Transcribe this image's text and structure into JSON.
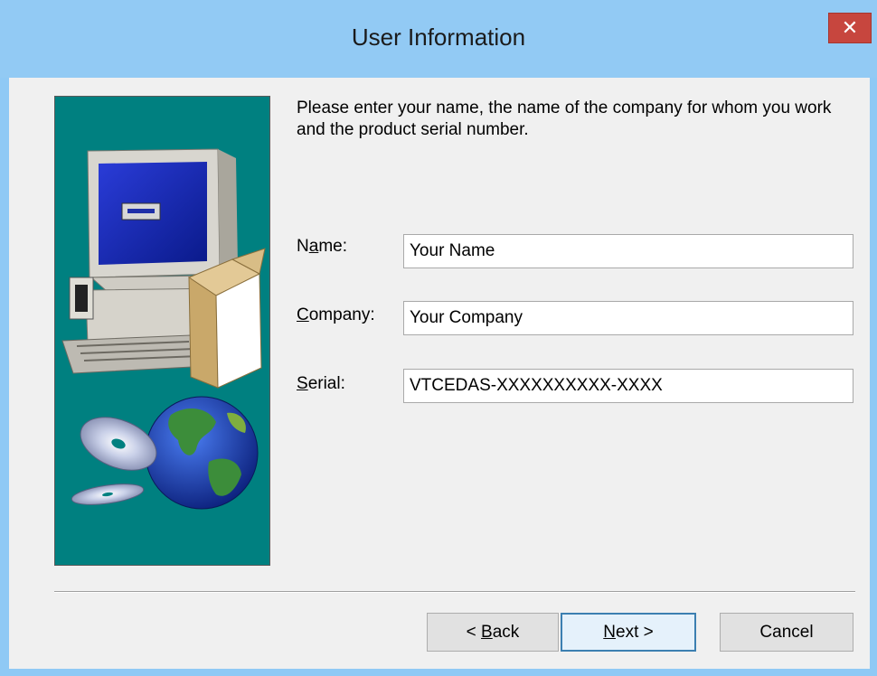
{
  "window": {
    "title": "User Information",
    "close_glyph": "✕"
  },
  "intro_text": "Please enter your name, the name of the company for whom you work and the product serial number.",
  "fields": {
    "name": {
      "label_pre": "N",
      "label_ul": "a",
      "label_post": "me:",
      "value": "Your Name"
    },
    "company": {
      "label_pre": "",
      "label_ul": "C",
      "label_post": "ompany:",
      "value": "Your Company"
    },
    "serial": {
      "label_pre": "",
      "label_ul": "S",
      "label_post": "erial:",
      "value": "VTCEDAS-XXXXXXXXXX-XXXX"
    }
  },
  "buttons": {
    "back": {
      "pre": "< ",
      "ul": "B",
      "post": "ack"
    },
    "next": {
      "pre": "",
      "ul": "N",
      "post": "ext >"
    },
    "cancel": {
      "label": "Cancel"
    }
  },
  "colors": {
    "titlebar": "#92caf4",
    "close_button": "#c7463e",
    "graphic_background": "#008080",
    "dialog_background": "#f0f0f0"
  },
  "graphic_icons": [
    "computer-monitor-icon",
    "software-box-icon",
    "cd-disc-icon",
    "globe-icon"
  ]
}
